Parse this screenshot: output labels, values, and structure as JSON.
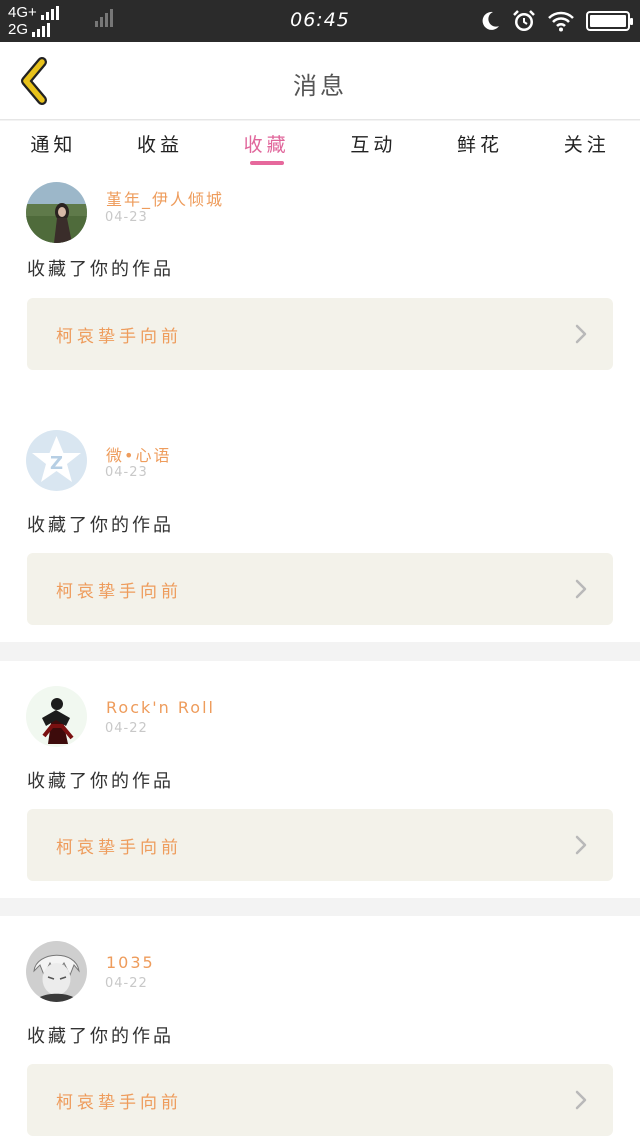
{
  "status_bar": {
    "net1": "4G+",
    "net2": "2G",
    "time": "06:45"
  },
  "header": {
    "title": "消息"
  },
  "tabs": [
    {
      "label": "通知"
    },
    {
      "label": "收益"
    },
    {
      "label": "收藏"
    },
    {
      "label": "互动"
    },
    {
      "label": "鲜花"
    },
    {
      "label": "关注"
    }
  ],
  "active_tab": "收藏",
  "items": [
    {
      "username": "堇年_伊人倾城",
      "date": "04-23",
      "action": "收藏了你的作品",
      "work_title": "柯哀挚手向前"
    },
    {
      "username": "微•心语",
      "date": "04-23",
      "action": "收藏了你的作品",
      "work_title": "柯哀挚手向前"
    },
    {
      "username": "Rock'n Roll",
      "date": "04-22",
      "action": "收藏了你的作品",
      "work_title": "柯哀挚手向前"
    },
    {
      "username": "1035",
      "date": "04-22",
      "action": "收藏了你的作品",
      "work_title": "柯哀挚手向前"
    }
  ],
  "colors": {
    "accent": "#e6689c",
    "username": "#ee9c5c",
    "back_icon": "#e8c21b",
    "card_bg": "#f3f2ea"
  }
}
